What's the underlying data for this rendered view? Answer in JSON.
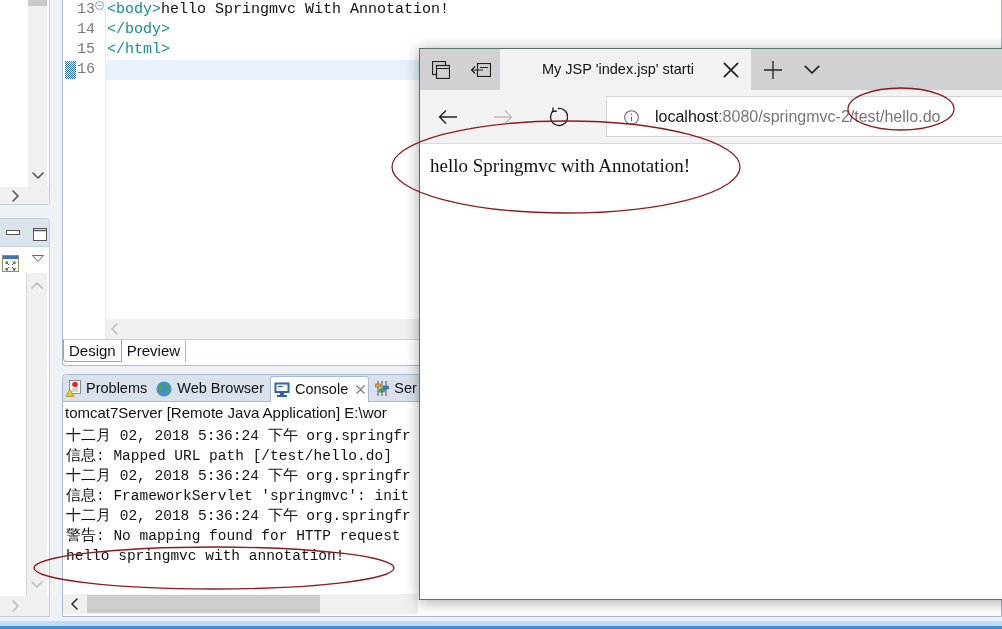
{
  "editor": {
    "lines": [
      {
        "number": "13",
        "folding": true,
        "changed": false,
        "current": false,
        "tokens": [
          {
            "kind": "tag",
            "text": "<body>"
          },
          {
            "kind": "text",
            "text": "hello Springmvc With Annotation!"
          }
        ]
      },
      {
        "number": "14",
        "folding": false,
        "changed": false,
        "current": false,
        "tokens": [
          {
            "kind": "tag",
            "text": "</body>"
          }
        ]
      },
      {
        "number": "15",
        "folding": false,
        "changed": false,
        "current": false,
        "tokens": [
          {
            "kind": "tag",
            "text": "</html>"
          }
        ]
      },
      {
        "number": "16",
        "folding": false,
        "changed": true,
        "current": true
      }
    ],
    "tabs": [
      {
        "label": "Design",
        "selected": true
      },
      {
        "label": "Preview",
        "selected": false
      }
    ]
  },
  "bottom_panel": {
    "tabs": [
      {
        "kind": "problems",
        "label": "Problems",
        "selected": false
      },
      {
        "kind": "web_browser",
        "label": "Web Browser",
        "selected": false
      },
      {
        "kind": "console",
        "label": "Console",
        "selected": true
      },
      {
        "kind": "servers",
        "label": "Ser",
        "selected": false
      }
    ],
    "console": {
      "title": "tomcat7Server [Remote Java Application] E:\\wor",
      "lines": [
        "十二月 02, 2018 5:36:24 下午 org.springfr",
        "信息: Mapped URL path [/test/hello.do]",
        "十二月 02, 2018 5:36:24 下午 org.springfr",
        "信息: FrameworkServlet 'springmvc': init",
        "十二月 02, 2018 5:36:24 下午 org.springfr",
        "警告: No mapping found for HTTP request",
        "hello springmvc with annotation!"
      ]
    }
  },
  "browser": {
    "tabs": [
      {
        "title": "My JSP 'index.jsp' starti",
        "selected": true
      }
    ],
    "nav_buttons": [
      {
        "kind": "back",
        "disabled": false
      },
      {
        "kind": "forward",
        "disabled": true
      },
      {
        "kind": "refresh",
        "disabled": false
      }
    ],
    "address": {
      "host": "localhost",
      "path": ":8080/springmvc-2/test/hello.do"
    },
    "page_text": "hello Springmvc with Annotation!"
  }
}
